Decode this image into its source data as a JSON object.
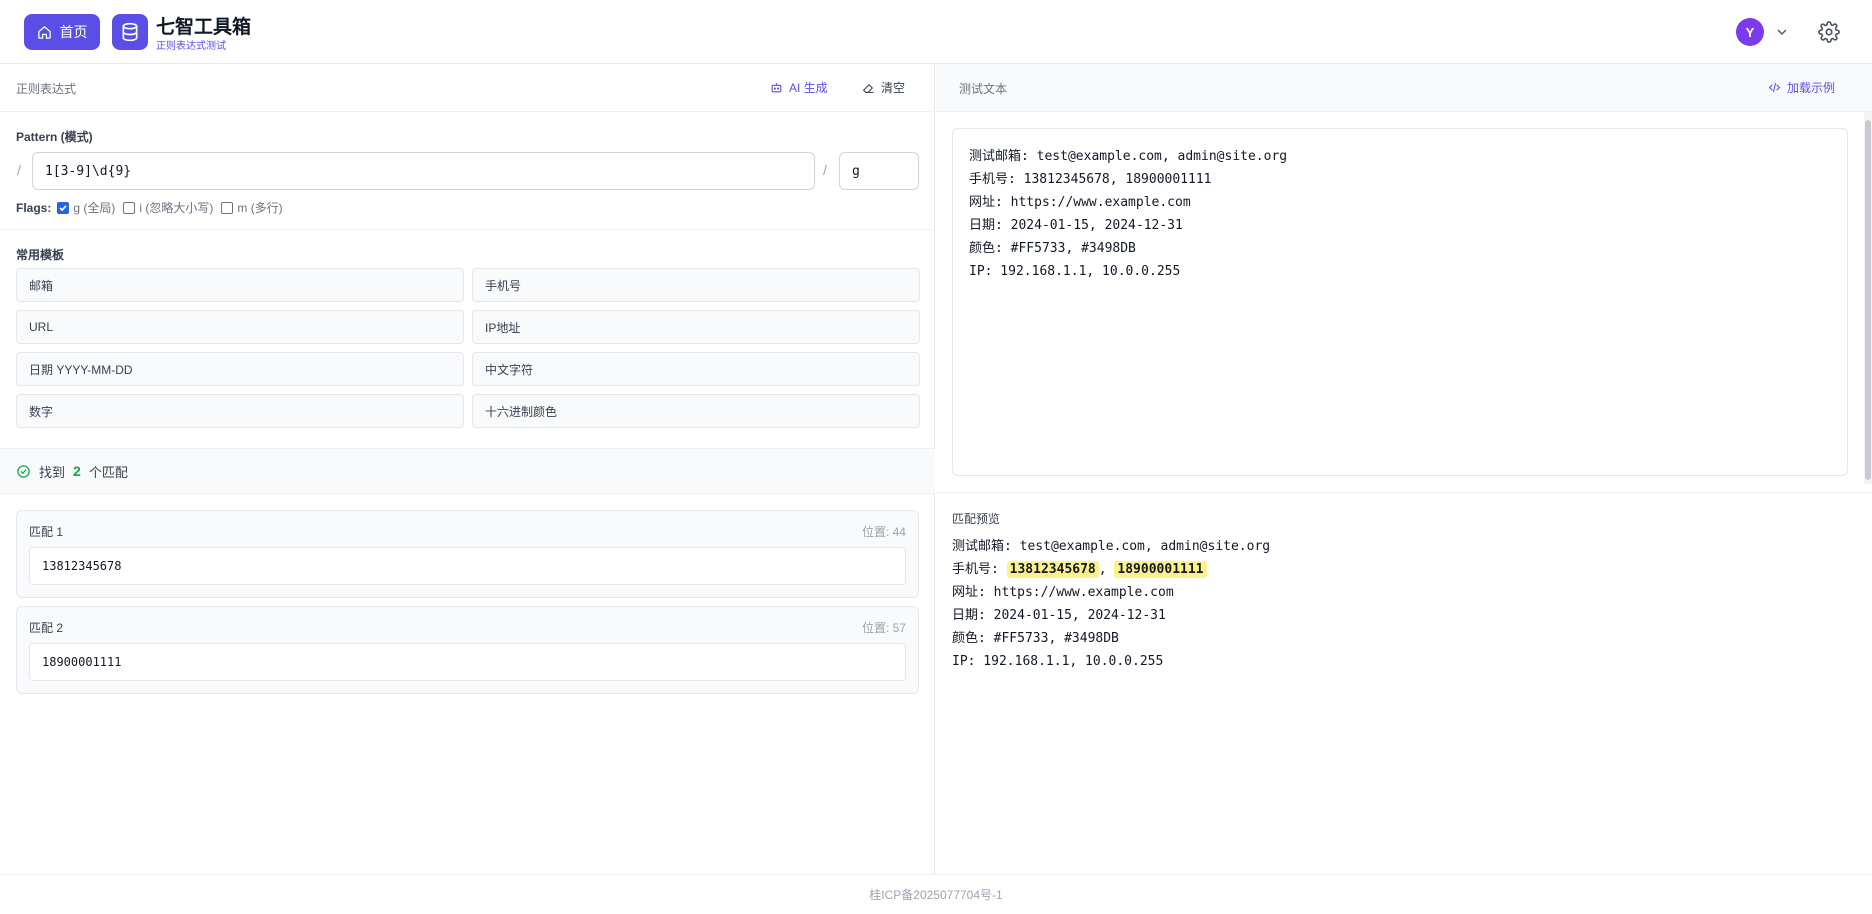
{
  "header": {
    "home_label": "首页",
    "app_title": "七智工具箱",
    "app_subtitle": "正则表达式测试",
    "avatar_letter": "Y"
  },
  "left": {
    "title": "正则表达式",
    "ai_label": "AI 生成",
    "clear_label": "清空",
    "pattern_label": "Pattern (模式)",
    "slash": "/",
    "pattern_value": "1[3-9]\\d{9}",
    "flags_value": "g",
    "flags_label": "Flags:",
    "flags": [
      {
        "label": "g (全局)",
        "checked": true
      },
      {
        "label": "i (忽略大小写)",
        "checked": false
      },
      {
        "label": "m (多行)",
        "checked": false
      }
    ],
    "templates_label": "常用模板",
    "templates": [
      "邮箱",
      "手机号",
      "URL",
      "IP地址",
      "日期 YYYY-MM-DD",
      "中文字符",
      "数字",
      "十六进制颜色"
    ],
    "found_prefix": "找到",
    "found_count": "2",
    "found_suffix": "个匹配",
    "matches": [
      {
        "label": "匹配 1",
        "position": "位置: 44",
        "value": "13812345678"
      },
      {
        "label": "匹配 2",
        "position": "位置: 57",
        "value": "18900001111"
      }
    ]
  },
  "right": {
    "title": "测试文本",
    "load_label": "加载示例",
    "test_text": "测试邮箱: test@example.com, admin@site.org\n手机号: 13812345678, 18900001111\n网址: https://www.example.com\n日期: 2024-01-15, 2024-12-31\n颜色: #FF5733, #3498DB\nIP: 192.168.1.1, 10.0.0.255",
    "preview_title": "匹配预览",
    "preview": {
      "line1": "测试邮箱: test@example.com, admin@site.org",
      "line2_prefix": "手机号: ",
      "line2_match1": "13812345678",
      "line2_sep": ", ",
      "line2_match2": "18900001111",
      "line3": "网址: https://www.example.com",
      "line4": "日期: 2024-01-15, 2024-12-31",
      "line5": "颜色: #FF5733, #3498DB",
      "line6": "IP: 192.168.1.1, 10.0.0.255"
    }
  },
  "footer": {
    "icp": "桂ICP备2025077704号-1"
  },
  "colors": {
    "accent": "#5b4ee6",
    "success": "#16a34a",
    "highlight": "#fef08a",
    "avatar": "#7c3aed"
  }
}
